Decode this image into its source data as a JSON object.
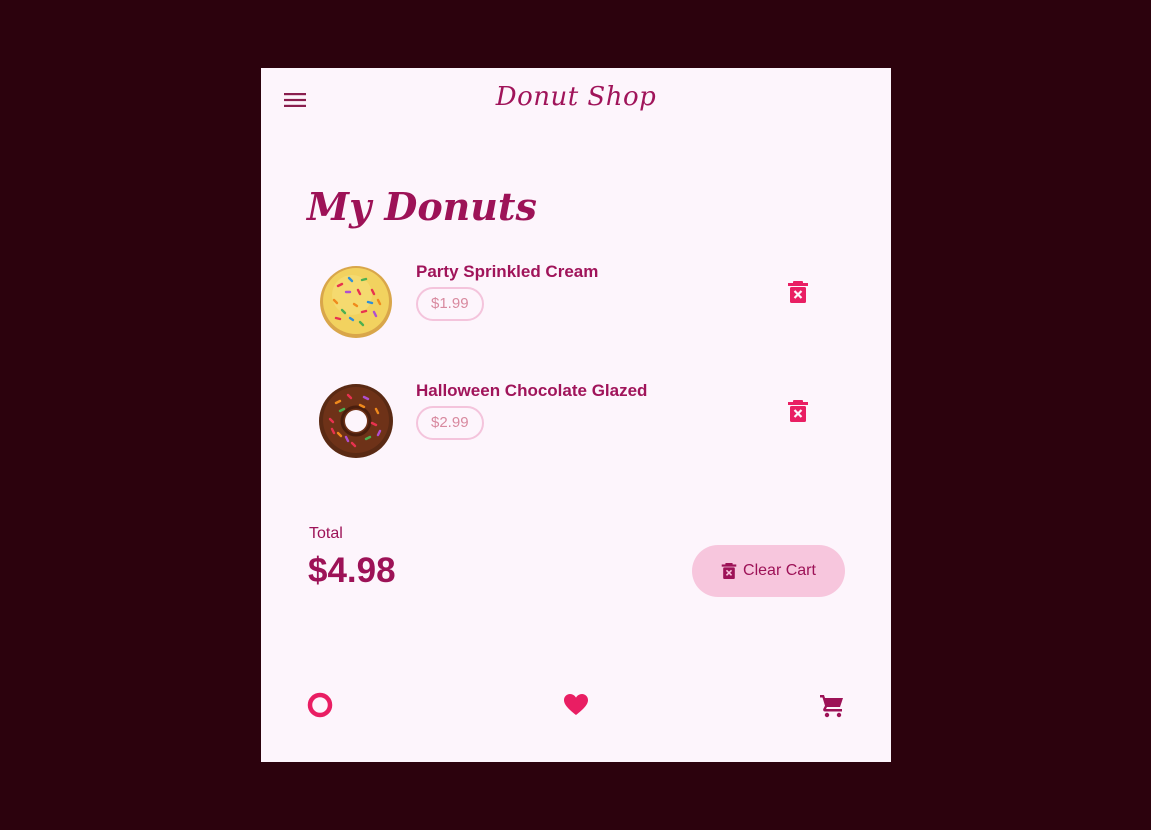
{
  "app": {
    "title": "Donut Shop"
  },
  "page": {
    "title": "My Donuts"
  },
  "cart": {
    "items": [
      {
        "name": "Party Sprinkled Cream",
        "price": "$1.99"
      },
      {
        "name": "Halloween Chocolate Glazed",
        "price": "$2.99"
      }
    ],
    "total_label": "Total",
    "total_value": "$4.98",
    "clear_label": "Clear Cart"
  },
  "icons": {
    "menu": "menu-icon",
    "delete": "delete-icon",
    "nav_donuts": "donut-icon",
    "nav_favorites": "heart-icon",
    "nav_cart": "cart-icon"
  },
  "colors": {
    "background": "#2c020d",
    "surface": "#fdf5fc",
    "primary": "#a0145a",
    "accent": "#e91e63",
    "chip_border": "#f4c4dc",
    "button_bg": "#f7c6dd"
  }
}
